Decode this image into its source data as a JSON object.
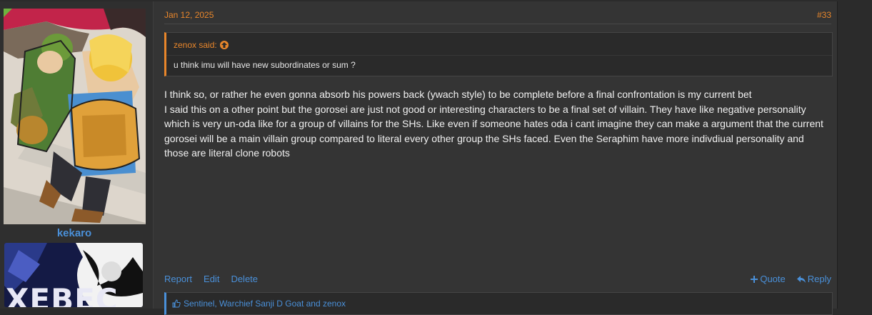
{
  "post": {
    "author": "kekaro",
    "date": "Jan 12, 2025",
    "number": "#33",
    "banner_text": "XEBEC",
    "quote": {
      "attribution": "zenox said:",
      "text": "u think imu will have new subordinates or sum ?"
    },
    "message": [
      "I think so, or rather he even gonna absorb his powers back (ywach style) to be complete before a final confrontation is my current bet",
      "I said this on a other point but the gorosei are just not good or interesting characters to be a final set of villain. They have like negative personality which is very un-oda like for a group of villains for the SHs. Like even if someone hates oda i cant imagine they can make a argument that the current gorosei will be a main villain group compared to literal every other group the SHs faced. Even the Seraphim have more indivdiual personality and those are literal clone robots"
    ],
    "actions": {
      "report": "Report",
      "edit": "Edit",
      "delete": "Delete",
      "quote": "Quote",
      "reply": "Reply"
    },
    "likes_text": "Sentinel, Warchief Sanji D Goat and zenox"
  },
  "colors": {
    "accent_orange": "#e8862b",
    "link_blue": "#4a90d9",
    "background": "#343434"
  },
  "icons": {
    "quote_up": "arrow-up-circle-icon",
    "quote_plus": "plus-icon",
    "reply": "reply-arrow-icon",
    "like": "thumbs-up-icon"
  }
}
